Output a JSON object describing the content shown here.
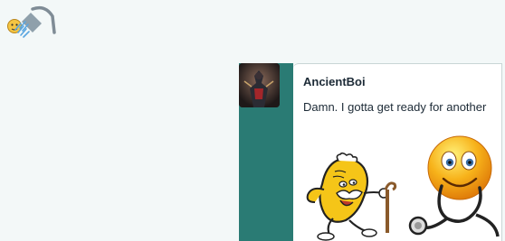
{
  "post": {
    "username": "AncientBoi",
    "text": "Damn. I gotta get ready for another"
  },
  "icons": {
    "top": "emoji-with-shower-icon",
    "sticker_1": "old-peanut-with-cane-sticker",
    "sticker_2": "doctor-smiley-with-stethoscope-sticker"
  },
  "colors": {
    "background": "#f3f8f8",
    "sidebar": "#2a7b74",
    "text": "#1c2a36"
  }
}
